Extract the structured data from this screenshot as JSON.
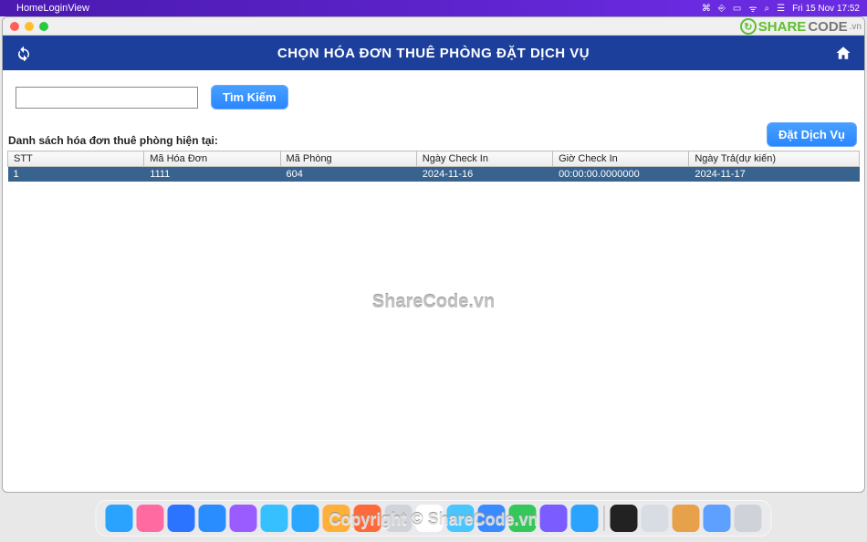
{
  "menubar": {
    "app_name": "HomeLoginView",
    "clock": "Fri 15 Nov  17:52"
  },
  "appbar": {
    "title": "CHỌN HÓA ĐƠN THUÊ PHÒNG ĐẶT DỊCH VỤ"
  },
  "search": {
    "value": "",
    "placeholder": "",
    "button_label": "Tìm Kiếm"
  },
  "list_label": "Danh sách hóa đơn thuê phòng hiện tại:",
  "service_button": "Đặt Dịch Vụ",
  "table": {
    "headers": [
      "STT",
      "Mã Hóa Đơn",
      "Mã Phòng",
      "Ngày Check In",
      "Giờ Check In",
      "Ngày Trả(dự kiến)"
    ],
    "rows": [
      {
        "cells": [
          "1",
          "1111",
          "604",
          "2024-11-16",
          "00:00:00.0000000",
          "2024-11-17"
        ],
        "selected": true
      }
    ]
  },
  "watermark_center": "ShareCode.vn",
  "watermark_bottom": "Copyright © ShareCode.vn",
  "logo": {
    "text1": "SHARE",
    "text2": "CODE",
    "suffix": ".vn"
  },
  "dock_colors": [
    "#2aa3ff",
    "#ff6aa0",
    "#2a74ff",
    "#2a8dff",
    "#9a5cff",
    "#37c0ff",
    "#2aa8ff",
    "#ffb03a",
    "#ff6a3a",
    "#d0d4da",
    "#ffffff",
    "#49c6ff",
    "#3a8bff",
    "#34c759",
    "#7a5cff",
    "#2aa3ff",
    "#222",
    "#d8dde4",
    "#e7a14a",
    "#5ea0ff",
    "#cfd3d9"
  ]
}
